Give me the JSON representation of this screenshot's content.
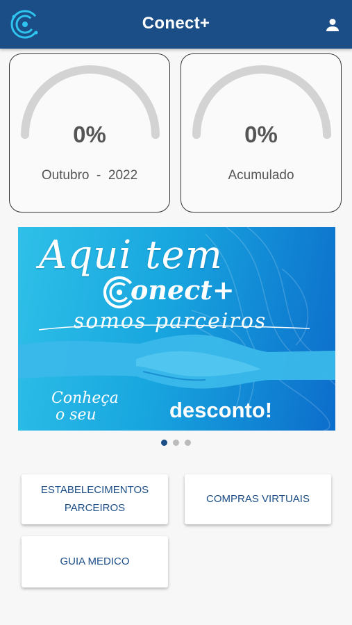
{
  "app": {
    "title": "Conect+"
  },
  "cards": [
    {
      "percent": "0%",
      "label": "Outubro  -  2022",
      "progress": 0
    },
    {
      "percent": "0%",
      "label": "Acumulado",
      "progress": 0
    }
  ],
  "banner": {
    "headline": "Aqui tem",
    "brand": "onect+",
    "tagline": "somos parceiros",
    "cta_line1": "Conheça",
    "cta_line2": "o seu",
    "discount": "desconto!"
  },
  "carousel": {
    "slides": 3,
    "active_index": 0
  },
  "buttons": {
    "partners": "ESTABELECIMENTOS PARCEIROS",
    "virtual": "COMPRAS VIRTUAIS",
    "medical": "GUIA MEDICO"
  },
  "icons": {
    "logo": "conect-logo-icon",
    "profile": "person-icon"
  },
  "colors": {
    "appbar": "#1b4d86",
    "gauge_track": "#d3d3d3",
    "accent": "#29b6e8"
  }
}
